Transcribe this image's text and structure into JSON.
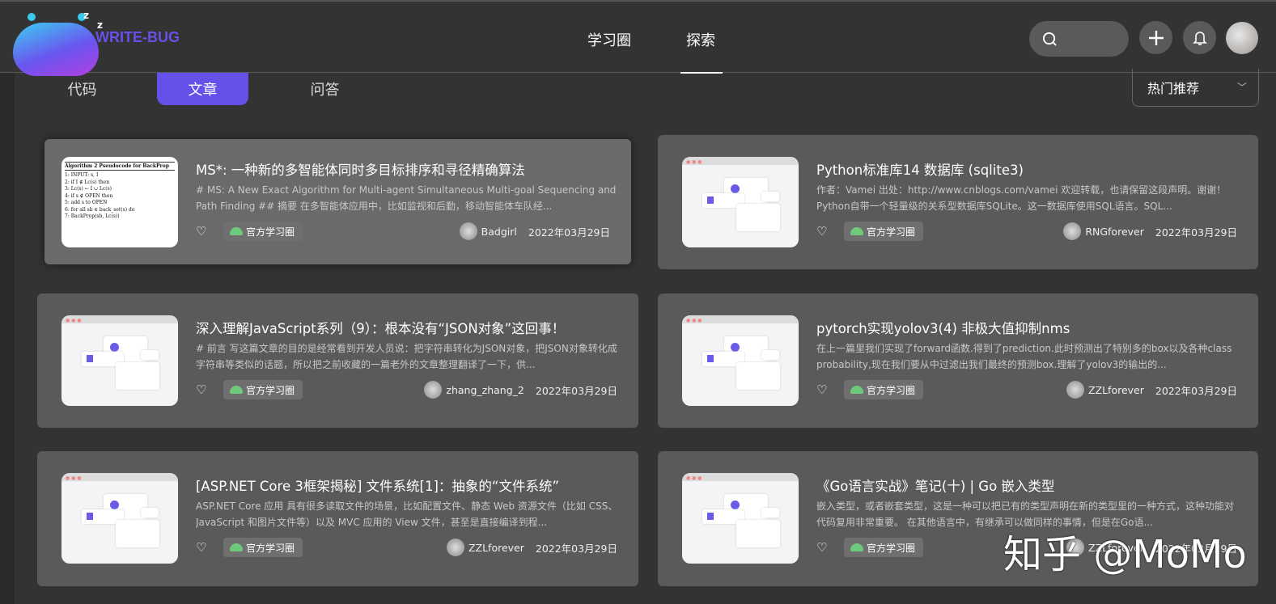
{
  "header": {
    "brand": "WRITE-BUG",
    "nav": [
      "学习圈",
      "探索"
    ],
    "active_nav": "探索"
  },
  "tabs": [
    "代码",
    "文章",
    "问答"
  ],
  "active_tab": "文章",
  "sort": {
    "selected": "热门推荐"
  },
  "tag_label": "官方学习圈",
  "thumb_algo": {
    "heading": "Algorithm 2 Pseudocode for BackProp",
    "lines": [
      "1: INPUT: s, I",
      "2: if I ∉ Lc(s) then",
      "3:   Lc(s) ← I ∪ Lc(s)",
      "4:   if s ∉ OPEN then",
      "5:     add s to OPEN",
      "6:   for all sb ∈ back_set(s) do",
      "7:     BackProp(sb, Lc(s))"
    ]
  },
  "articles": [
    {
      "title": "MS*: 一种新的多智能体同时多目标排序和寻径精确算法",
      "desc": "# MS: A New Exact Algorithm for Multi-agent Simultaneous Multi-goal Sequencing and Path Finding ## 摘要 在多智能体应用中，比如监视和后勤，移动智能体车队经...",
      "author": "Badgirl",
      "date": "2022年03月29日"
    },
    {
      "title": "Python标准库14 数据库 (sqlite3)",
      "desc": "作者：Vamei 出处：http://www.cnblogs.com/vamei 欢迎转载，也请保留这段声明。谢谢！ Python自带一个轻量级的关系型数据库SQLite。这一数据库使用SQL语言。SQL...",
      "author": "RNGforever",
      "date": "2022年03月29日"
    },
    {
      "title": "深入理解JavaScript系列（9）：根本没有“JSON对象”这回事！",
      "desc": "# 前言 写这篇文章的目的是经常看到开发人员说：把字符串转化为JSON对象，把JSON对象转化成字符串等类似的话题，所以把之前收藏的一篇老外的文章整理翻译了一下，供...",
      "author": "zhang_zhang_2",
      "date": "2022年03月29日"
    },
    {
      "title": "pytorch实现yolov3(4) 非极大值抑制nms",
      "desc": "在上一篇里我们实现了forward函数.得到了prediction.此时预测出了特别多的box以及各种class probability,现在我们要从中过滤出我们最终的预测box.理解了yolov3的输出的...",
      "author": "ZZLforever",
      "date": "2022年03月29日"
    },
    {
      "title": "[ASP.NET Core 3框架揭秘] 文件系统[1]：抽象的“文件系统”",
      "desc": "ASP.NET Core 应用 具有很多读取文件的场景，比如配置文件、静态 Web 资源文件（比如 CSS、JavaScript 和图片文件等）以及 MVC 应用的 View 文件，甚至是直接编译到程...",
      "author": "ZZLforever",
      "date": "2022年03月29日"
    },
    {
      "title": "《Go语言实战》笔记(十) | Go 嵌入类型",
      "desc": "嵌入类型，或者嵌套类型，这是一种可以把已有的类型声明在新的类型里的一种方式，这种功能对代码复用非常重要。 在其他语言中，有继承可以做同样的事情，但是在Go语...",
      "author": "ZZLforever",
      "date": "2022年03月29日"
    }
  ],
  "watermark": "知乎 @MoMo",
  "colors": {
    "accent": "#6550ea",
    "card": "#5a5a5a",
    "bg": "#333333",
    "tag_icon": "#6fc97a"
  }
}
